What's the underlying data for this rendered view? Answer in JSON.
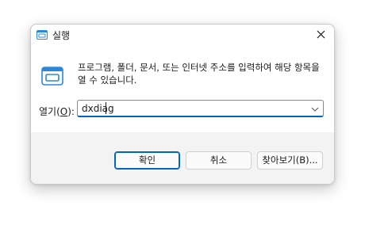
{
  "window": {
    "title": "실행",
    "title_icon": "run-icon",
    "close_icon": "close-icon"
  },
  "main": {
    "icon": "run-icon",
    "description": "프로그램, 폴더, 문서, 또는 인터넷 주소를 입력하여 해당 항목을 열 수 있습니다.",
    "open_label_prefix": "열기(",
    "open_label_accel": "O",
    "open_label_suffix": "):",
    "input_value": "dxdiag",
    "dropdown_icon": "chevron-down-icon"
  },
  "buttons": {
    "ok": "확인",
    "cancel": "취소",
    "browse": "찾아보기(B)..."
  },
  "colors": {
    "accent": "#0067c0",
    "icon_blue": "#2b88d8",
    "footer_bg": "#f3f3f3"
  }
}
